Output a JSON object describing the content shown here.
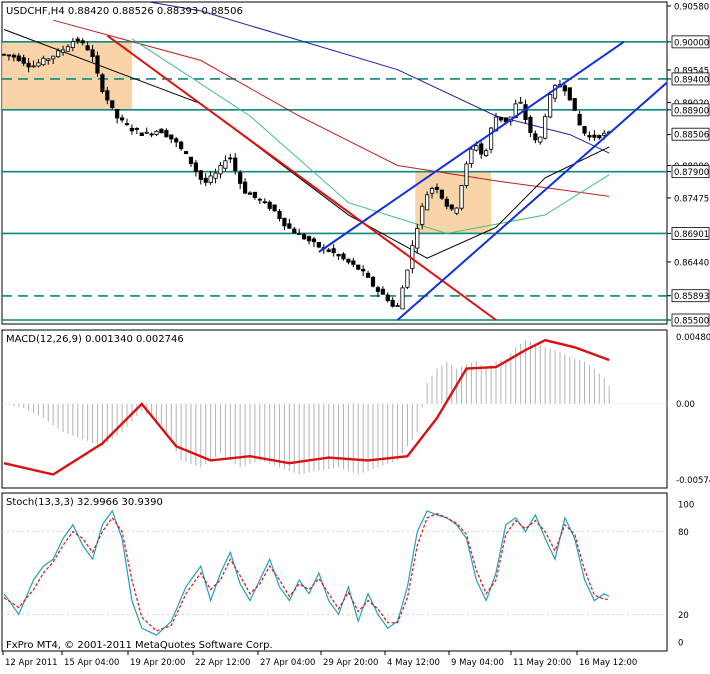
{
  "main": {
    "header": "USDCHF,H4  0.88420 0.88526 0.88393 0.88506",
    "price_range": [
      0.855,
      0.9058
    ],
    "price_ticks": [
      "0.90580",
      "0.90000",
      "0.89545",
      "0.89400",
      "0.89020",
      "0.88900",
      "0.88500",
      "0.88000",
      "0.87900",
      "0.87475",
      "0.86901",
      "0.86440",
      "0.85893",
      "0.85500"
    ],
    "highlighted_labels": [
      "0.90000",
      "0.89400",
      "0.88900",
      "0.88506",
      "0.87900",
      "0.86901",
      "0.85893",
      "0.85500"
    ],
    "horizontal_levels": [
      {
        "price": 0.9,
        "style": "solid"
      },
      {
        "price": 0.894,
        "style": "dashed"
      },
      {
        "price": 0.889,
        "style": "solid"
      },
      {
        "price": 0.879,
        "style": "solid"
      },
      {
        "price": 0.869,
        "style": "solid"
      },
      {
        "price": 0.8589,
        "style": "dashed"
      },
      {
        "price": 0.855,
        "style": "solid"
      }
    ],
    "current_price": 0.88506,
    "colors": {
      "level": "#0a8a80",
      "channel": "#1030e0",
      "trendline": "#e01010",
      "ma_blue": "#2020a0",
      "ma_red": "#c02020",
      "ma_green": "#40c080",
      "ma_black": "#000000",
      "zone": "#f8cc99",
      "candle_up": "#ffffff",
      "candle_down": "#000000"
    }
  },
  "macd": {
    "header": "MACD(12,26,9) 0.001340 0.002746",
    "range": [
      -0.00574,
      0.0048
    ],
    "ticks": [
      "0.00480",
      "0.00",
      "-0.00574"
    ],
    "colors": {
      "histogram": "#b4b4b4",
      "signal": "#dd1010"
    }
  },
  "stoch": {
    "header": "Stoch(13,3,3) 32.9966 30.9390",
    "range": [
      0,
      100
    ],
    "ticks": [
      "100",
      "80",
      "20",
      "0"
    ],
    "colors": {
      "main": "#20a0c0",
      "signal": "#dd1010"
    }
  },
  "x_axis": {
    "labels": [
      "12 Apr 2011",
      "15 Apr 04:00",
      "19 Apr 20:00",
      "22 Apr 12:00",
      "27 Apr 04:00",
      "29 Apr 20:00",
      "4 May 12:00",
      "9 May 04:00",
      "11 May 20:00",
      "16 May 12:00"
    ]
  },
  "copyright": "FxPro MT4, © 2001-2011 MetaQuotes Software Corp.",
  "chart_data": {
    "type": "candlestick",
    "symbol": "USDCHF",
    "timeframe": "H4",
    "ohlc_last": {
      "open": 0.8842,
      "high": 0.88526,
      "low": 0.88393,
      "close": 0.88506
    },
    "close_path": [
      [
        0,
        0.898
      ],
      [
        3,
        0.8975
      ],
      [
        6,
        0.896
      ],
      [
        9,
        0.8972
      ],
      [
        12,
        0.8985
      ],
      [
        15,
        0.9005
      ],
      [
        18,
        0.8985
      ],
      [
        20,
        0.893
      ],
      [
        23,
        0.888
      ],
      [
        26,
        0.886
      ],
      [
        29,
        0.885
      ],
      [
        32,
        0.8858
      ],
      [
        35,
        0.884
      ],
      [
        38,
        0.881
      ],
      [
        41,
        0.877
      ],
      [
        44,
        0.879
      ],
      [
        46,
        0.882
      ],
      [
        49,
        0.876
      ],
      [
        52,
        0.8745
      ],
      [
        55,
        0.873
      ],
      [
        58,
        0.87
      ],
      [
        61,
        0.8685
      ],
      [
        64,
        0.867
      ],
      [
        67,
        0.866
      ],
      [
        70,
        0.8645
      ],
      [
        73,
        0.863
      ],
      [
        76,
        0.86
      ],
      [
        79,
        0.858
      ],
      [
        80,
        0.856
      ],
      [
        82,
        0.862
      ],
      [
        84,
        0.869
      ],
      [
        86,
        0.875
      ],
      [
        88,
        0.877
      ],
      [
        90,
        0.874
      ],
      [
        92,
        0.872
      ],
      [
        94,
        0.879
      ],
      [
        96,
        0.884
      ],
      [
        98,
        0.881
      ],
      [
        100,
        0.888
      ],
      [
        103,
        0.887
      ],
      [
        105,
        0.891
      ],
      [
        107,
        0.886
      ],
      [
        109,
        0.883
      ],
      [
        111,
        0.8905
      ],
      [
        113,
        0.8935
      ],
      [
        115,
        0.892
      ],
      [
        117,
        0.887
      ],
      [
        119,
        0.8845
      ],
      [
        121,
        0.8848
      ],
      [
        123,
        0.8851
      ]
    ],
    "moving_averages": {
      "blue": [
        [
          0,
          0.9105
        ],
        [
          40,
          0.905
        ],
        [
          80,
          0.8955
        ],
        [
          100,
          0.888
        ],
        [
          115,
          0.885
        ],
        [
          123,
          0.882
        ]
      ],
      "red": [
        [
          10,
          0.9035
        ],
        [
          40,
          0.897
        ],
        [
          60,
          0.888
        ],
        [
          80,
          0.88
        ],
        [
          100,
          0.8775
        ],
        [
          123,
          0.875
        ]
      ],
      "green": [
        [
          26,
          0.9005
        ],
        [
          50,
          0.888
        ],
        [
          70,
          0.874
        ],
        [
          90,
          0.869
        ],
        [
          110,
          0.872
        ],
        [
          123,
          0.8785
        ]
      ],
      "black": [
        [
          0,
          0.902
        ],
        [
          40,
          0.89
        ],
        [
          70,
          0.872
        ],
        [
          86,
          0.865
        ],
        [
          100,
          0.87
        ],
        [
          110,
          0.878
        ],
        [
          123,
          0.883
        ]
      ]
    },
    "trendlines": {
      "red": [
        [
          21,
          0.901
        ],
        [
          100,
          0.855
        ]
      ],
      "channel_top": [
        [
          64,
          0.866
        ],
        [
          126,
          0.9
        ]
      ],
      "channel_bottom": [
        [
          80,
          0.855
        ],
        [
          137,
          0.895
        ]
      ]
    },
    "zones": [
      {
        "x": [
          0,
          26
        ],
        "y": [
          0.889,
          0.9
        ]
      },
      {
        "x": [
          84,
          99
        ],
        "y": [
          0.869,
          0.879
        ]
      }
    ],
    "macd_signal": [
      [
        0,
        -0.0042
      ],
      [
        10,
        -0.005
      ],
      [
        20,
        -0.0028
      ],
      [
        28,
        0.0
      ],
      [
        35,
        -0.003
      ],
      [
        42,
        -0.004
      ],
      [
        50,
        -0.0037
      ],
      [
        58,
        -0.0042
      ],
      [
        66,
        -0.0038
      ],
      [
        74,
        -0.004
      ],
      [
        82,
        -0.0037
      ],
      [
        88,
        -0.001
      ],
      [
        94,
        0.0025
      ],
      [
        100,
        0.0026
      ],
      [
        106,
        0.0038
      ],
      [
        110,
        0.0045
      ],
      [
        116,
        0.004
      ],
      [
        123,
        0.0031
      ]
    ],
    "macd_histogram": [
      [
        0,
        0.0
      ],
      [
        4,
        -0.0003
      ],
      [
        8,
        -0.001
      ],
      [
        12,
        -0.002
      ],
      [
        16,
        -0.0025
      ],
      [
        20,
        -0.003
      ],
      [
        24,
        -0.002
      ],
      [
        28,
        -0.0005
      ],
      [
        32,
        -0.0015
      ],
      [
        36,
        -0.004
      ],
      [
        40,
        -0.0045
      ],
      [
        44,
        -0.0035
      ],
      [
        48,
        -0.0045
      ],
      [
        52,
        -0.004
      ],
      [
        56,
        -0.0045
      ],
      [
        60,
        -0.005
      ],
      [
        64,
        -0.0047
      ],
      [
        68,
        -0.0045
      ],
      [
        72,
        -0.005
      ],
      [
        76,
        -0.0045
      ],
      [
        80,
        -0.004
      ],
      [
        84,
        -0.002
      ],
      [
        86,
        0.0015
      ],
      [
        88,
        0.0025
      ],
      [
        90,
        0.003
      ],
      [
        92,
        0.0025
      ],
      [
        94,
        0.0028
      ],
      [
        96,
        0.003
      ],
      [
        98,
        0.0025
      ],
      [
        100,
        0.003
      ],
      [
        102,
        0.0032
      ],
      [
        104,
        0.004
      ],
      [
        106,
        0.0045
      ],
      [
        108,
        0.0043
      ],
      [
        110,
        0.004
      ],
      [
        112,
        0.0038
      ],
      [
        114,
        0.0035
      ],
      [
        116,
        0.0032
      ],
      [
        118,
        0.003
      ],
      [
        120,
        0.0025
      ],
      [
        122,
        0.0018
      ],
      [
        123,
        0.0013
      ]
    ],
    "stoch_main": [
      [
        0,
        35
      ],
      [
        3,
        20
      ],
      [
        6,
        45
      ],
      [
        8,
        55
      ],
      [
        10,
        60
      ],
      [
        12,
        75
      ],
      [
        14,
        85
      ],
      [
        16,
        70
      ],
      [
        18,
        60
      ],
      [
        20,
        85
      ],
      [
        22,
        95
      ],
      [
        24,
        75
      ],
      [
        26,
        30
      ],
      [
        28,
        10
      ],
      [
        31,
        5
      ],
      [
        34,
        15
      ],
      [
        37,
        40
      ],
      [
        40,
        55
      ],
      [
        42,
        30
      ],
      [
        44,
        50
      ],
      [
        46,
        65
      ],
      [
        48,
        42
      ],
      [
        50,
        30
      ],
      [
        52,
        45
      ],
      [
        54,
        60
      ],
      [
        56,
        40
      ],
      [
        58,
        30
      ],
      [
        60,
        45
      ],
      [
        62,
        35
      ],
      [
        64,
        50
      ],
      [
        66,
        30
      ],
      [
        68,
        20
      ],
      [
        70,
        40
      ],
      [
        72,
        15
      ],
      [
        74,
        35
      ],
      [
        76,
        20
      ],
      [
        78,
        10
      ],
      [
        80,
        15
      ],
      [
        82,
        40
      ],
      [
        84,
        80
      ],
      [
        86,
        95
      ],
      [
        88,
        92
      ],
      [
        90,
        90
      ],
      [
        92,
        85
      ],
      [
        94,
        75
      ],
      [
        96,
        45
      ],
      [
        98,
        30
      ],
      [
        100,
        50
      ],
      [
        102,
        85
      ],
      [
        104,
        90
      ],
      [
        106,
        80
      ],
      [
        108,
        92
      ],
      [
        110,
        75
      ],
      [
        112,
        60
      ],
      [
        114,
        90
      ],
      [
        116,
        75
      ],
      [
        118,
        45
      ],
      [
        120,
        30
      ],
      [
        122,
        35
      ],
      [
        123,
        33
      ]
    ],
    "stoch_signal": [
      [
        0,
        32
      ],
      [
        3,
        25
      ],
      [
        6,
        38
      ],
      [
        8,
        50
      ],
      [
        10,
        58
      ],
      [
        12,
        70
      ],
      [
        14,
        80
      ],
      [
        16,
        75
      ],
      [
        18,
        65
      ],
      [
        20,
        80
      ],
      [
        22,
        90
      ],
      [
        24,
        80
      ],
      [
        26,
        45
      ],
      [
        28,
        18
      ],
      [
        31,
        8
      ],
      [
        34,
        12
      ],
      [
        37,
        35
      ],
      [
        40,
        50
      ],
      [
        42,
        38
      ],
      [
        44,
        45
      ],
      [
        46,
        60
      ],
      [
        48,
        48
      ],
      [
        50,
        35
      ],
      [
        52,
        42
      ],
      [
        54,
        55
      ],
      [
        56,
        45
      ],
      [
        58,
        33
      ],
      [
        60,
        42
      ],
      [
        62,
        38
      ],
      [
        64,
        46
      ],
      [
        66,
        35
      ],
      [
        68,
        24
      ],
      [
        70,
        36
      ],
      [
        72,
        22
      ],
      [
        74,
        30
      ],
      [
        76,
        24
      ],
      [
        78,
        14
      ],
      [
        80,
        14
      ],
      [
        82,
        32
      ],
      [
        84,
        70
      ],
      [
        86,
        90
      ],
      [
        88,
        93
      ],
      [
        90,
        90
      ],
      [
        92,
        86
      ],
      [
        94,
        78
      ],
      [
        96,
        52
      ],
      [
        98,
        35
      ],
      [
        100,
        45
      ],
      [
        102,
        78
      ],
      [
        104,
        88
      ],
      [
        106,
        82
      ],
      [
        108,
        88
      ],
      [
        110,
        80
      ],
      [
        112,
        66
      ],
      [
        114,
        85
      ],
      [
        116,
        78
      ],
      [
        118,
        52
      ],
      [
        120,
        34
      ],
      [
        122,
        31
      ],
      [
        123,
        31
      ]
    ]
  }
}
